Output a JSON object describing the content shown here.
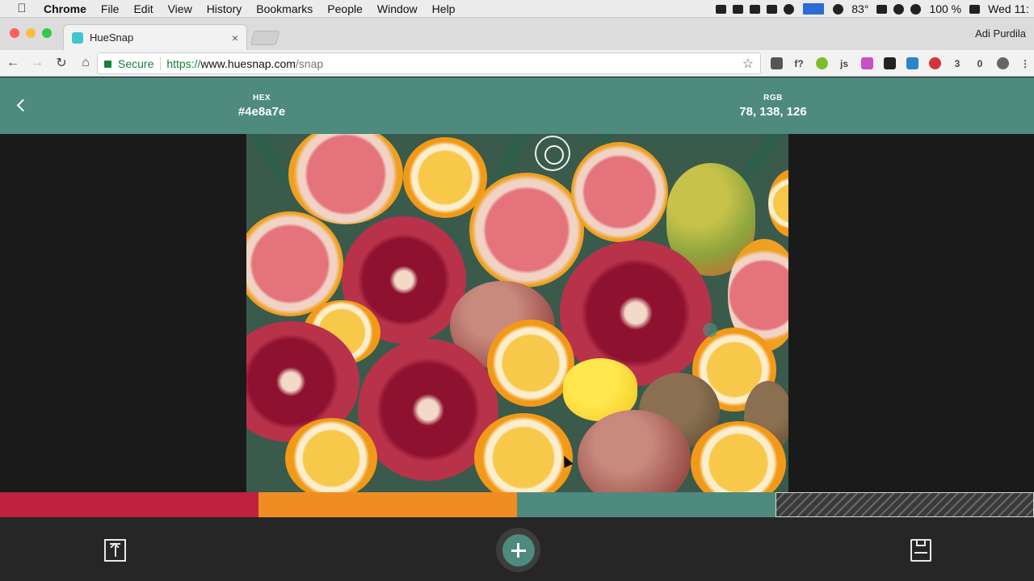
{
  "menubar": {
    "app_name": "Chrome",
    "items": [
      "File",
      "Edit",
      "View",
      "History",
      "Bookmarks",
      "People",
      "Window",
      "Help"
    ],
    "temperature": "83°",
    "battery": "100 %",
    "clock": "Wed 11:"
  },
  "browser": {
    "tab": {
      "title": "HueSnap",
      "close": "×"
    },
    "profile": "Adi Purdila",
    "security_label": "Secure",
    "url": {
      "scheme": "https://",
      "host": "www.huesnap.com",
      "path": "/snap"
    },
    "extension_badges": [
      "f?",
      "js",
      "3",
      "0"
    ]
  },
  "app": {
    "header": {
      "hex_label": "HEX",
      "hex_value": "#4e8a7e",
      "rgb_label": "RGB",
      "rgb_value": "78, 138, 126"
    },
    "palette": {
      "swatches": [
        "#c0213e",
        "#ef8d22",
        "#4e8a7e"
      ],
      "empty_slots": 1
    }
  },
  "colors": {
    "accent": "#4e8a7e",
    "header_bg": "#4e8a7e",
    "bottombar_bg": "#262626",
    "stage_bg": "#1a1a1a"
  },
  "icons": [
    "apple-icon",
    "back-arrow-icon",
    "picker-reticle-icon",
    "export-icon",
    "add-icon",
    "save-icon",
    "star-icon",
    "lock-icon"
  ]
}
